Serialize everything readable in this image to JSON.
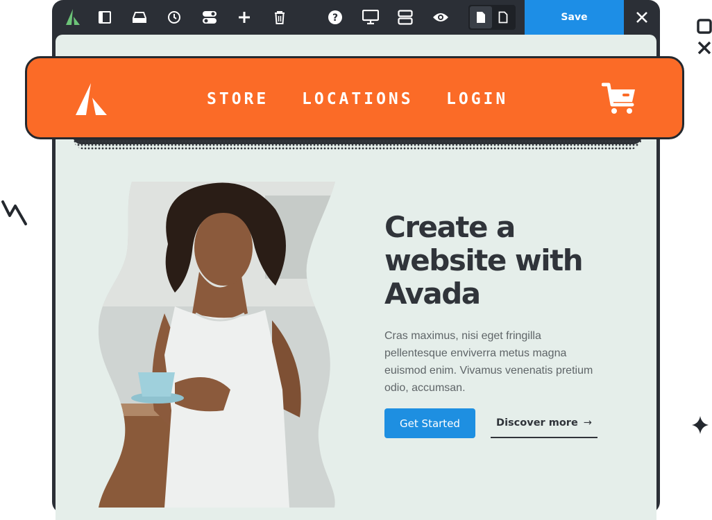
{
  "toolbar": {
    "icons": [
      "avada-logo-icon",
      "sidebar-panel-icon",
      "layout-section-icon",
      "history-clock-icon",
      "toggle-options-icon",
      "add-plus-icon",
      "trash-icon",
      "help-icon",
      "desktop-preview-icon",
      "layout-rows-icon",
      "preview-eye-icon"
    ],
    "view_toggle": [
      "page-filled-icon",
      "page-outline-icon"
    ],
    "save_label": "Save",
    "accent": "#1d8ee6"
  },
  "nav": {
    "bg": "#fb6b27",
    "links": [
      "STORE",
      "LOCATIONS",
      "LOGIN"
    ]
  },
  "hero": {
    "headline": "Create a website with Avada",
    "paragraph": "Cras maximus, nisi eget fringilla pellentesque  enviverra metus magna euismod enim. Vivamus venenatis pretium odio, accumsan.",
    "primary_button": "Get Started",
    "secondary_button": "Discover more",
    "secondary_arrow": "→"
  },
  "decor": [
    "restore-window-icon",
    "close-icon",
    "zigzag-doodle",
    "sparkle-icon"
  ]
}
